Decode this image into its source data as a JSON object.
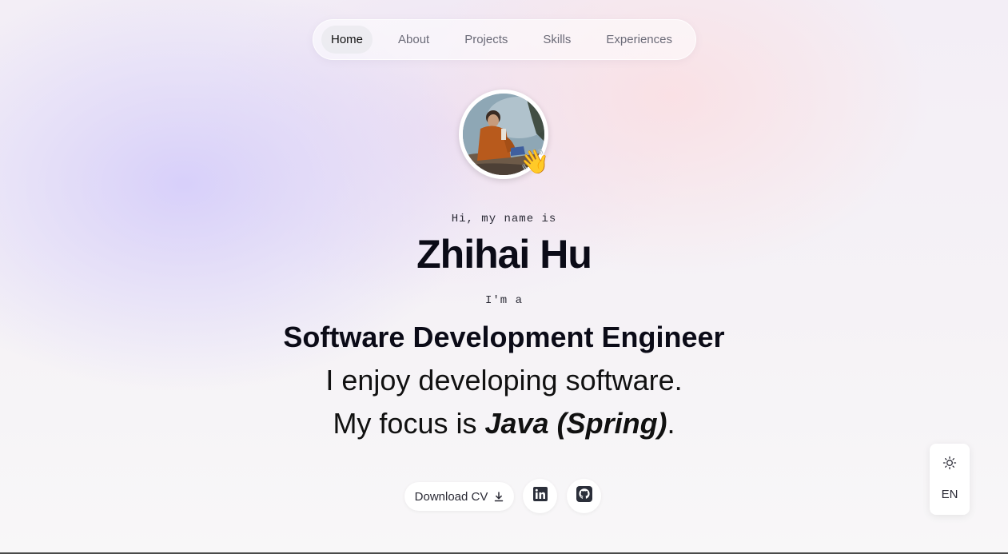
{
  "nav": {
    "items": [
      {
        "label": "Home",
        "active": true
      },
      {
        "label": "About",
        "active": false
      },
      {
        "label": "Projects",
        "active": false
      },
      {
        "label": "Skills",
        "active": false
      },
      {
        "label": "Experiences",
        "active": false
      }
    ]
  },
  "hero": {
    "avatar_icon": "profile-photo",
    "wave_emoji": "👋",
    "greeting": "Hi, my name is",
    "name": "Zhihai Hu",
    "im_a": "I'm a",
    "role": "Software Development Engineer",
    "enjoy": "I enjoy developing software.",
    "focus_prefix": "My focus is ",
    "focus_tech": "Java (Spring)",
    "focus_suffix": "."
  },
  "actions": {
    "download_cv_label": "Download CV",
    "download_icon": "download-icon",
    "linkedin_icon": "linkedin-icon",
    "github_icon": "github-icon"
  },
  "side_panel": {
    "theme_icon": "sun-icon",
    "language": "EN"
  }
}
